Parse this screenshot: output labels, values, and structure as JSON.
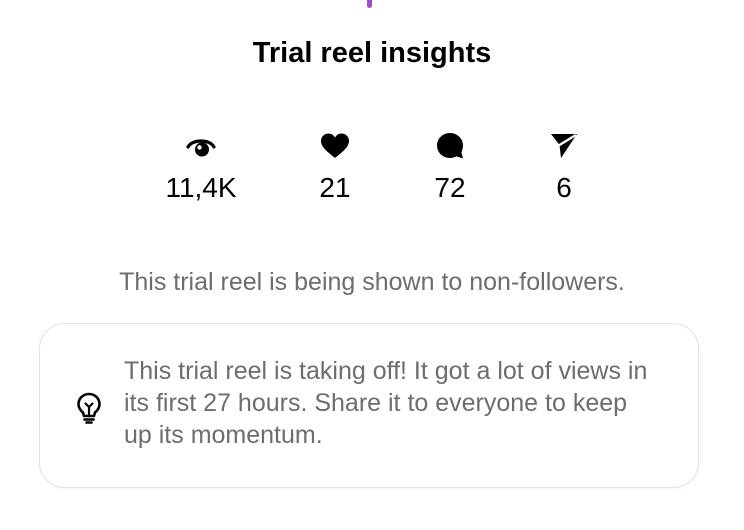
{
  "colors": {
    "accent_handle": "#9b4dca",
    "icon": "#000000",
    "muted_text": "#6b6d70",
    "card_border": "#e3e4e6"
  },
  "header": {
    "title": "Trial reel insights"
  },
  "stats": [
    {
      "icon": "eye-icon",
      "value": "11,4K"
    },
    {
      "icon": "heart-icon",
      "value": "21"
    },
    {
      "icon": "comment-icon",
      "value": "72"
    },
    {
      "icon": "share-icon",
      "value": "6"
    }
  ],
  "notice": "This trial reel is being shown to non-followers.",
  "tip": {
    "icon": "lightbulb-icon",
    "text": "This trial reel is taking off! It got a lot of views in its first 27 hours. Share it to everyone to keep up its momentum."
  }
}
